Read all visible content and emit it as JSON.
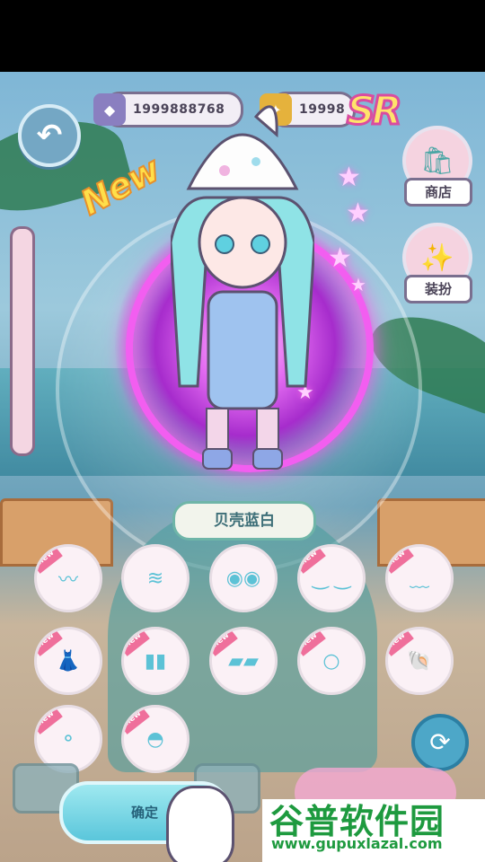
{
  "currency": {
    "gems": "1999888768",
    "tickets": "19998"
  },
  "badges": {
    "rarity": "SR",
    "new": "New"
  },
  "side_buttons": {
    "shop_label": "商店",
    "dressup_label": "装扮"
  },
  "item": {
    "name": "贝壳蓝白"
  },
  "slots": [
    {
      "icon": "hair-bangs-icon",
      "new": "new"
    },
    {
      "icon": "hair-long-icon",
      "new": ""
    },
    {
      "icon": "eyes-icon",
      "new": ""
    },
    {
      "icon": "face-closed-eyes-icon",
      "new": "new"
    },
    {
      "icon": "mouth-icon",
      "new": "new"
    },
    {
      "icon": "dress-icon",
      "new": "new"
    },
    {
      "icon": "socks-icon",
      "new": "new"
    },
    {
      "icon": "shoes-icon",
      "new": "new"
    },
    {
      "icon": "face-blank-icon",
      "new": "new"
    },
    {
      "icon": "shell-hat-icon",
      "new": "new"
    },
    {
      "icon": "necklace-icon",
      "new": "new"
    },
    {
      "icon": "shell-bag-icon",
      "new": "new"
    }
  ],
  "buttons": {
    "confirm_label": "确定"
  },
  "watermark": {
    "title": "谷普软件园",
    "url": "www.gupuxlazal.com"
  }
}
